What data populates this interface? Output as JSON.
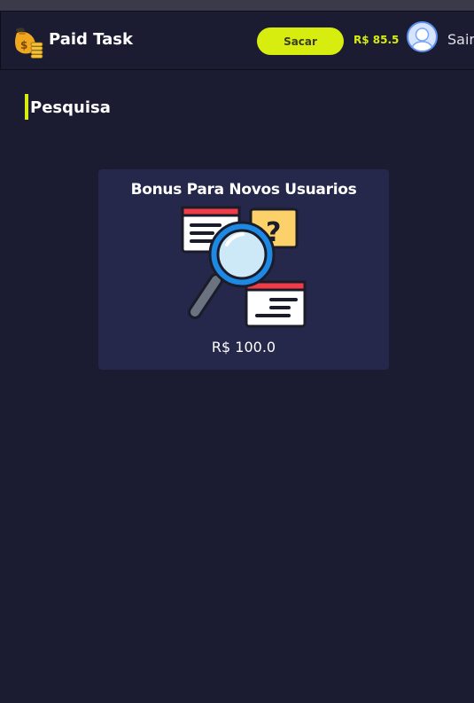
{
  "header": {
    "brand": "Paid Task",
    "withdraw_label": "Sacar",
    "balance": "R$ 85.5",
    "logout_label": "Sair"
  },
  "section": {
    "title": "Pesquisa"
  },
  "tasks": [
    {
      "title": "Bonus Para Novos Usuarios",
      "price": "R$ 100.0"
    }
  ],
  "colors": {
    "background": "#1b1c31",
    "card": "#25284a",
    "accent": "#d7ed10",
    "text": "#ffffff"
  },
  "icons": {
    "logo": "money-bag-icon",
    "avatar": "user-avatar-icon",
    "task": "survey-magnifier-icon"
  }
}
